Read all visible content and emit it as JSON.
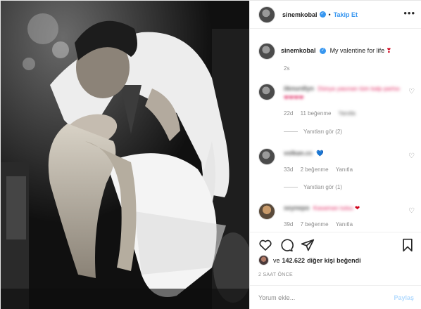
{
  "header": {
    "username": "sinemkobal",
    "separator": "•",
    "follow_label": "Takip Et",
    "more_icon": "more-horizontal-icon"
  },
  "caption": {
    "username": "sinemkobal",
    "text": "My valentine for life",
    "emoji": "❣",
    "time": "2s"
  },
  "comments": [
    {
      "author": "iiknurdlyn",
      "text": "Dünya yasınan tüm kalp parlısı",
      "emoji": "❤❤❤❤",
      "age": "22d",
      "likes": "11 beğenme",
      "reply": "Yanıtla",
      "view_replies": "Yanıtları gör (2)"
    },
    {
      "author": "volkan.cc",
      "text": "",
      "emoji": "💙",
      "age": "33d",
      "likes": "2 beğenme",
      "reply": "Yanıtla",
      "view_replies": "Yanıtları gör (1)"
    },
    {
      "author": "seynepo",
      "text": "Kasaman tutsu",
      "emoji": "❤",
      "age": "39d",
      "likes": "7 beğenme",
      "reply": "Yanıtla",
      "view_replies": ""
    }
  ],
  "actions": {
    "like_icon": "heart-icon",
    "comment_icon": "comment-icon",
    "share_icon": "paper-plane-icon",
    "save_icon": "bookmark-icon"
  },
  "likes": {
    "prefix": "ve",
    "count": "142.622",
    "suffix": "diğer kişi beğendi"
  },
  "posted_ago": "2 SAAT ÖNCE",
  "comment_input": {
    "placeholder": "Yorum ekle...",
    "submit_label": "Paylaş"
  },
  "colors": {
    "accent": "#3897f0",
    "muted": "#8e8e8e",
    "text": "#262626",
    "heart_red": "#d0021b"
  }
}
